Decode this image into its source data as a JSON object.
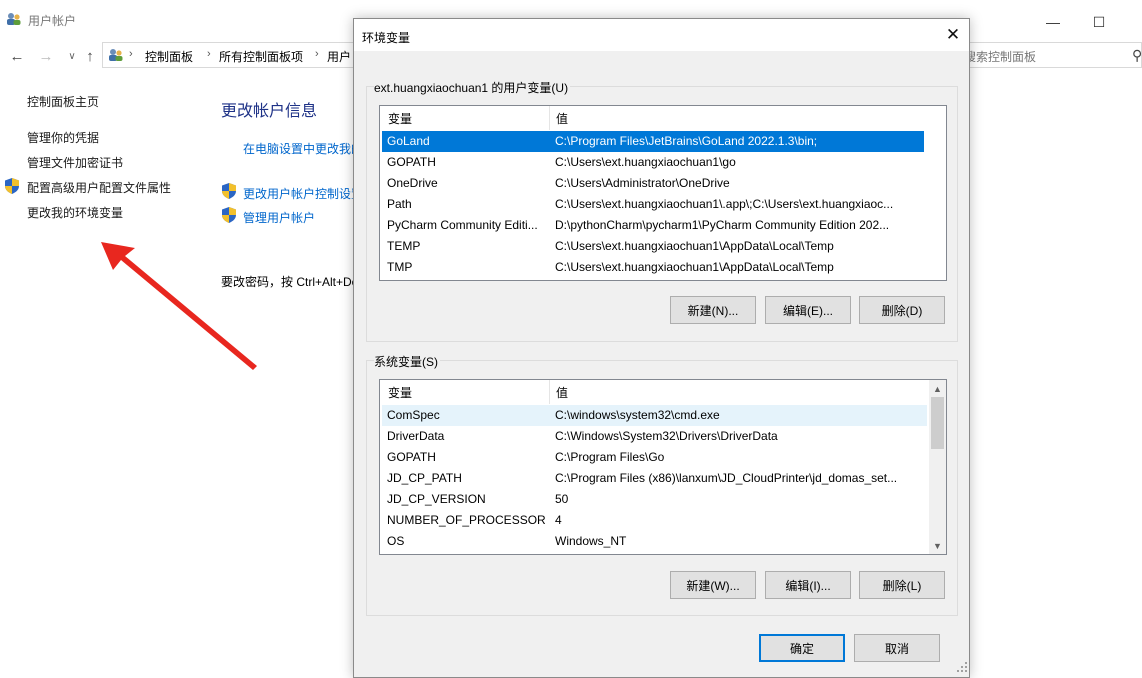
{
  "background_window": {
    "title": "用户帐户",
    "breadcrumb": [
      "控制面板",
      "所有控制面板项",
      "用户"
    ],
    "search_placeholder": "搜索控制面板",
    "sidebar": {
      "home": "控制面板主页",
      "links": [
        "管理你的凭据",
        "管理文件加密证书",
        "配置高级用户配置文件属性",
        "更改我的环境变量"
      ]
    },
    "main": {
      "heading": "更改帐户信息",
      "link_pc_settings": "在电脑设置中更改我的",
      "link_uac": "更改用户帐户控制设置",
      "link_manage": "管理用户帐户",
      "password_text": "要改密码，按 Ctrl+Alt+De"
    }
  },
  "dialog": {
    "title": "环境变量",
    "user_group_label": "ext.huangxiaochuan1 的用户变量(U)",
    "system_group_label": "系统变量(S)",
    "col_variable": "变量",
    "col_value": "值",
    "user_vars": [
      {
        "name": "GoLand",
        "value": "C:\\Program Files\\JetBrains\\GoLand 2022.1.3\\bin;"
      },
      {
        "name": "GOPATH",
        "value": "C:\\Users\\ext.huangxiaochuan1\\go"
      },
      {
        "name": "OneDrive",
        "value": "C:\\Users\\Administrator\\OneDrive"
      },
      {
        "name": "Path",
        "value": "C:\\Users\\ext.huangxiaochuan1\\.app\\;C:\\Users\\ext.huangxiaoc..."
      },
      {
        "name": "PyCharm Community Editi...",
        "value": "D:\\pythonCharm\\pycharm1\\PyCharm Community Edition 202..."
      },
      {
        "name": "TEMP",
        "value": "C:\\Users\\ext.huangxiaochuan1\\AppData\\Local\\Temp"
      },
      {
        "name": "TMP",
        "value": "C:\\Users\\ext.huangxiaochuan1\\AppData\\Local\\Temp"
      }
    ],
    "system_vars": [
      {
        "name": "ComSpec",
        "value": "C:\\windows\\system32\\cmd.exe"
      },
      {
        "name": "DriverData",
        "value": "C:\\Windows\\System32\\Drivers\\DriverData"
      },
      {
        "name": "GOPATH",
        "value": "C:\\Program Files\\Go"
      },
      {
        "name": "JD_CP_PATH",
        "value": "C:\\Program Files (x86)\\lanxum\\JD_CloudPrinter\\jd_domas_set..."
      },
      {
        "name": "JD_CP_VERSION",
        "value": "50"
      },
      {
        "name": "NUMBER_OF_PROCESSORS",
        "value": "4"
      },
      {
        "name": "OS",
        "value": "Windows_NT"
      }
    ],
    "user_buttons": {
      "new": "新建(N)...",
      "edit": "编辑(E)...",
      "delete": "删除(D)"
    },
    "system_buttons": {
      "new": "新建(W)...",
      "edit": "编辑(I)...",
      "delete": "删除(L)"
    },
    "ok": "确定",
    "cancel": "取消",
    "selected_user_row": 0,
    "hover_system_row": 0
  },
  "colors": {
    "selection": "#0078d7",
    "link": "#0066cc",
    "heading": "#1e3287",
    "arrow": "#e8271f"
  }
}
